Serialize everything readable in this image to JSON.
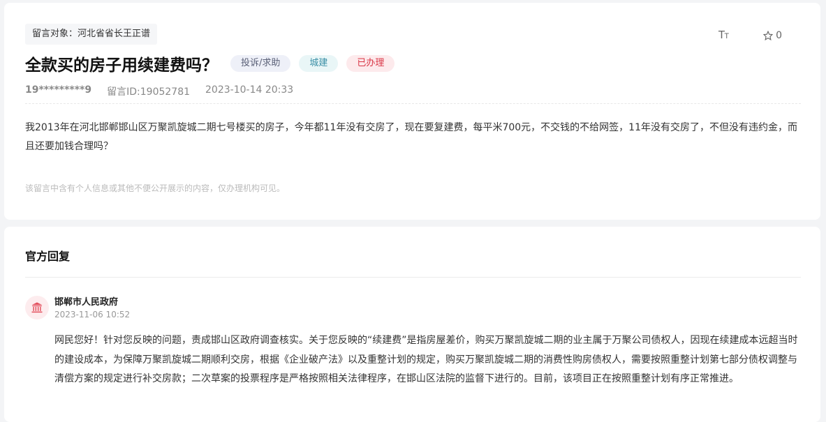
{
  "message": {
    "target": "留言对象：河北省省长王正谱",
    "title": "全款买的房子用续建费吗？",
    "tags": {
      "type": "投诉/求助",
      "category": "城建",
      "status": "已办理"
    },
    "user": "19*********9",
    "message_id": "留言ID:19052781",
    "datetime": "2023-10-14 20:33",
    "content": "我2013年在河北邯郸邯山区万聚凯旋城二期七号楼买的房子，今年都11年没有交房了，现在要复建费，每平米700元，不交钱的不给网签，11年没有交房了，不但没有违约金，而且还要加钱合理吗？",
    "privacy_note": "该留言中含有个人信息或其他不便公开展示的内容，仅办理机构可见。",
    "font_icon": {
      "big": "T",
      "small": "T"
    },
    "favorite_count": "0",
    "colors": {
      "status": "#d93545",
      "category": "#3b8fa6",
      "type": "#5a6077"
    }
  },
  "reply": {
    "section_title": "官方回复",
    "org_name": "邯郸市人民政府",
    "datetime": "2023-11-06 10:52",
    "content": "网民您好！针对您反映的问题，责成邯山区政府调查核实。关于您反映的“续建费”是指房屋差价，购买万聚凯旋城二期的业主属于万聚公司债权人，因现在续建成本远超当时的建设成本，为保障万聚凯旋城二期顺利交房，根据《企业破产法》以及重整计划的规定，购买万聚凯旋城二期的消费性购房债权人，需要按照重整计划第七部分债权调整与清偿方案的规定进行补交房款；二次草案的投票程序是严格按照相关法律程序，在邯山区法院的监督下进行的。目前，该项目正在按照重整计划有序正常推进。",
    "avatar_icon": "government-building-icon"
  }
}
